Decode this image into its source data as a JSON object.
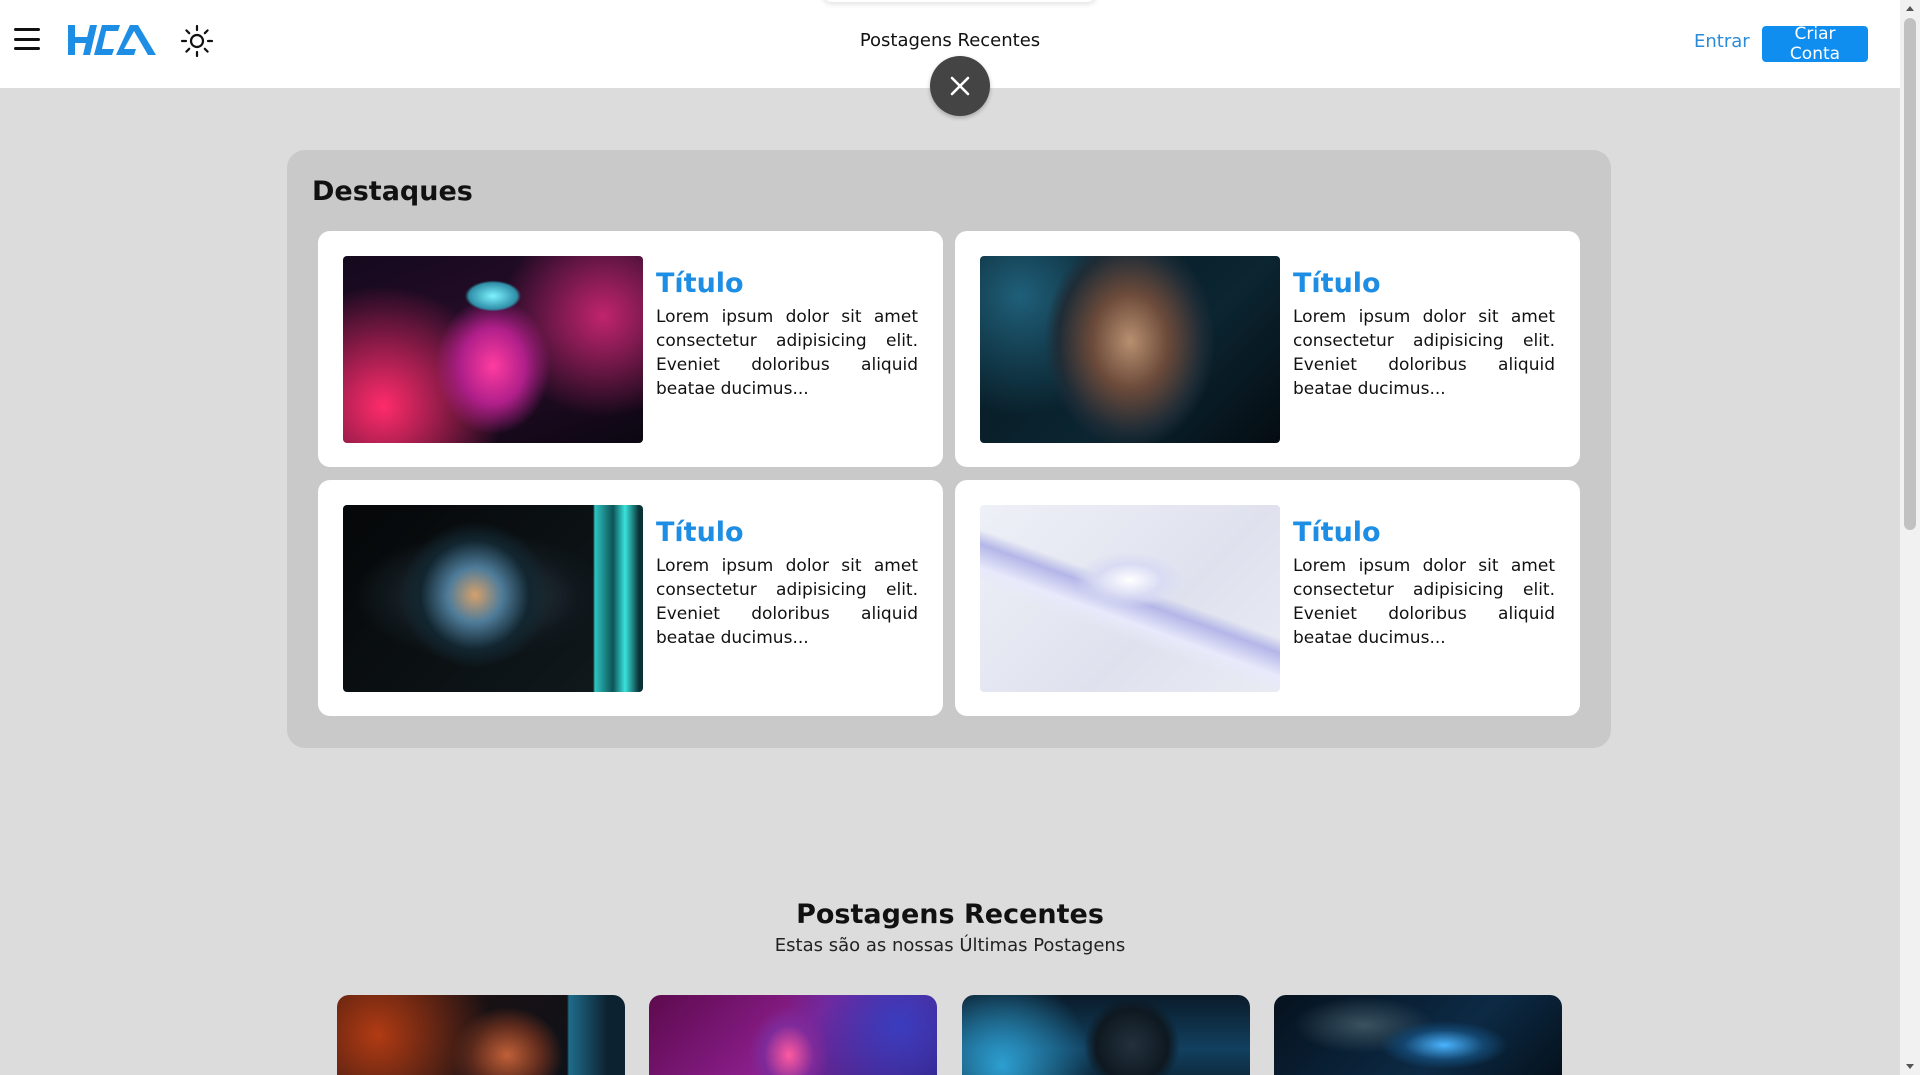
{
  "header": {
    "menu_icon": "hamburger-menu-icon",
    "logo_text": "HCA",
    "theme_icon": "sun-icon",
    "nav_title": "Postagens Recentes",
    "close_icon": "close-icon",
    "login_label": "Entrar",
    "signup_label": "Criar Conta"
  },
  "colors": {
    "accent": "#1d8ee4",
    "button": "#0f8ef0",
    "page_bg": "#dcdcdc",
    "panel_bg": "#c9c9c9",
    "close_button": "#444444"
  },
  "highlights": {
    "title": "Destaques",
    "cards": [
      {
        "title": "Título",
        "body": "Lorem ipsum dolor sit amet consectetur adipisicing elit. Eveniet doloribus aliquid beatae ducimus...",
        "image": "neon-vr-headset-person"
      },
      {
        "title": "Título",
        "body": "Lorem ipsum dolor sit amet consectetur adipisicing elit. Eveniet doloribus aliquid beatae ducimus...",
        "image": "digital-network-face"
      },
      {
        "title": "Título",
        "body": "Lorem ipsum dolor sit amet consectetur adipisicing elit. Eveniet doloribus aliquid beatae ducimus...",
        "image": "cyber-eye-closeup"
      },
      {
        "title": "Título",
        "body": "Lorem ipsum dolor sit amet consectetur adipisicing elit. Eveniet doloribus aliquid beatae ducimus...",
        "image": "robotic-hand"
      }
    ]
  },
  "recent": {
    "title": "Postagens Recentes",
    "subtitle": "Estas são as nossas Últimas Postagens",
    "posts": [
      {
        "image": "neon-face-data"
      },
      {
        "image": "vr-pink-hologram"
      },
      {
        "image": "vr-city-night"
      },
      {
        "image": "hands-keyboard-blue"
      }
    ]
  }
}
